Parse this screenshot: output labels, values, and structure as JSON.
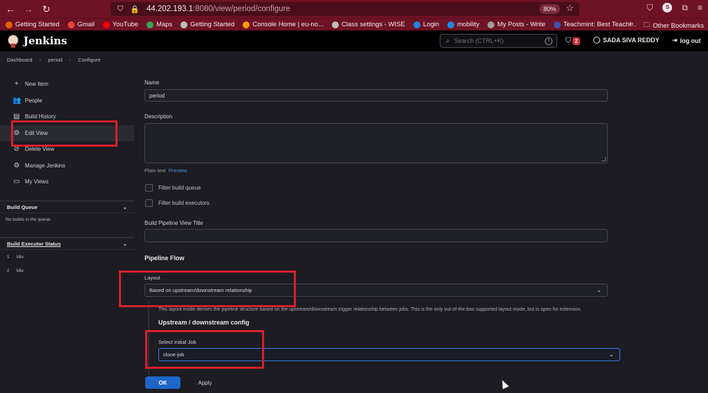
{
  "browser": {
    "url_host": "44.202.193.1",
    "url_rest": ":8080/view/period/configure",
    "zoom": "80%",
    "profile_initial": "S",
    "bookmarks": [
      {
        "label": "Getting Started",
        "color": "#e66000"
      },
      {
        "label": "Gmail",
        "color": "#ea4335"
      },
      {
        "label": "YouTube",
        "color": "#ff0000"
      },
      {
        "label": "Maps",
        "color": "#34a853"
      },
      {
        "label": "Getting Started",
        "color": "#bdbdbd"
      },
      {
        "label": "Console Home | eu-no...",
        "color": "#ff9900"
      },
      {
        "label": "Class settings - WISE",
        "color": "#bdbdbd"
      },
      {
        "label": "Login",
        "color": "#1e88e5"
      },
      {
        "label": "mobility",
        "color": "#1e88e5"
      },
      {
        "label": "My Posts - Write",
        "color": "#9e9e9e"
      },
      {
        "label": "Teachmint: Best Teachi...",
        "color": "#3f51b5"
      }
    ],
    "other_bookmarks": "Other Bookmarks"
  },
  "header": {
    "title": "Jenkins",
    "search_placeholder": "Search (CTRL+K)",
    "alert_count": "2",
    "user_name": "SADA SIVA REDDY",
    "logout_label": "log out"
  },
  "breadcrumb": [
    "Dashboard",
    "period",
    "Configure"
  ],
  "sidebar": {
    "items": [
      {
        "label": "New Item",
        "icon": "+"
      },
      {
        "label": "People",
        "icon": "👥"
      },
      {
        "label": "Build History",
        "icon": "▤"
      },
      {
        "label": "Edit View",
        "icon": "⚙"
      },
      {
        "label": "Delete View",
        "icon": "⊘"
      },
      {
        "label": "Manage Jenkins",
        "icon": "⚙"
      },
      {
        "label": "My Views",
        "icon": "▭"
      }
    ],
    "build_queue": {
      "title": "Build Queue",
      "empty_text": "No builds in the queue."
    },
    "executor_status": {
      "title": "Build Executor Status",
      "executors": [
        {
          "num": "1",
          "state": "Idle"
        },
        {
          "num": "2",
          "state": "Idle"
        }
      ]
    }
  },
  "form": {
    "name_label": "Name",
    "name_value": "period",
    "description_label": "Description",
    "description_value": "",
    "plain_text": "Plain text",
    "preview_link": "Preview",
    "filter_queue_label": "Filter build queue",
    "filter_executors_label": "Filter build executors",
    "pipeline_title_label": "Build Pipeline View Title",
    "pipeline_title_value": "",
    "pipeline_flow_heading": "Pipeline Flow",
    "layout_label": "Layout",
    "layout_value": "Based on upstream/downstream relationship",
    "layout_description": "This layout mode derives the pipeline structure based on the upstream/downstream trigger relationship between jobs. This is the only out-of-the-box supported layout mode, but is open for extension.",
    "upstream_heading": "Upstream / downstream config",
    "initial_job_label": "Select Initial Job",
    "initial_job_value": "clone-job",
    "ok_label": "OK",
    "apply_label": "Apply"
  }
}
